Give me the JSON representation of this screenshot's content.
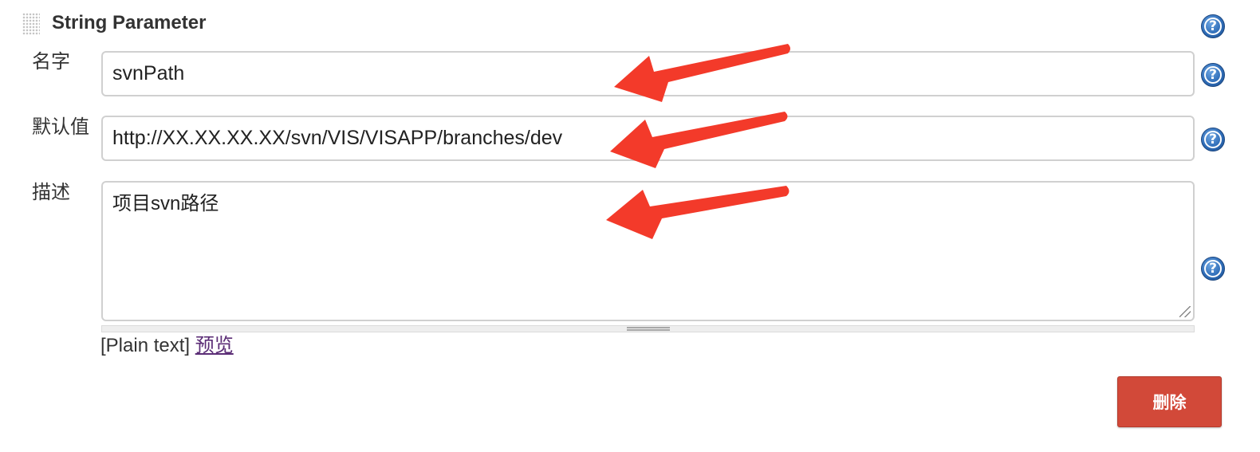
{
  "section": {
    "title": "String Parameter"
  },
  "fields": {
    "name": {
      "label": "名字",
      "value": "svnPath"
    },
    "default_value": {
      "label": "默认值",
      "value": "http://XX.XX.XX.XX/svn/VIS/VISAPP/branches/dev"
    },
    "description": {
      "label": "描述",
      "value": "项目svn路径"
    }
  },
  "format": {
    "plain_text": "[Plain text]",
    "preview_link": "预览"
  },
  "actions": {
    "delete_label": "删除"
  },
  "help": {
    "glyph": "?"
  },
  "colors": {
    "delete_button": "#d24939",
    "annotation_arrow": "#f33a2a",
    "help_icon": "#2f6db8",
    "link": "#5b2d76"
  }
}
